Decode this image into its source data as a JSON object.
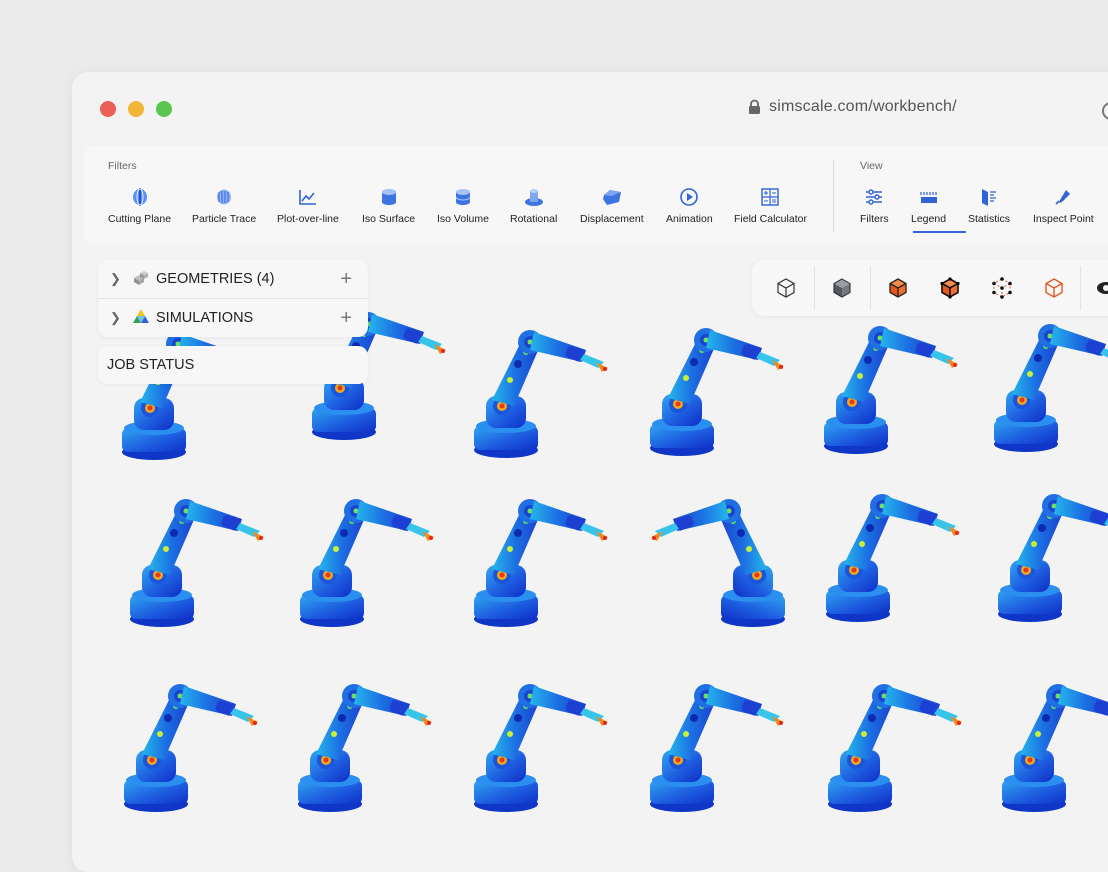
{
  "browser": {
    "url": "simscale.com/workbench/",
    "colors": {
      "close": "#ec5f57",
      "minimize": "#f1b637",
      "maximize": "#5ac64f"
    }
  },
  "toolbar": {
    "filters_title": "Filters",
    "view_title": "View",
    "filters": [
      {
        "label": "Cutting Plane",
        "icon": "cutting-plane-icon"
      },
      {
        "label": "Particle Trace",
        "icon": "particle-trace-icon"
      },
      {
        "label": "Plot-over-line",
        "icon": "plot-over-line-icon"
      },
      {
        "label": "Iso Surface",
        "icon": "iso-surface-icon"
      },
      {
        "label": "Iso Volume",
        "icon": "iso-volume-icon"
      },
      {
        "label": "Rotational",
        "icon": "rotational-icon"
      },
      {
        "label": "Displacement",
        "icon": "displacement-icon"
      },
      {
        "label": "Animation",
        "icon": "animation-icon"
      },
      {
        "label": "Field Calculator",
        "icon": "field-calculator-icon"
      }
    ],
    "view": [
      {
        "label": "Filters",
        "icon": "filters-icon"
      },
      {
        "label": "Legend",
        "icon": "legend-icon",
        "active": true
      },
      {
        "label": "Statistics",
        "icon": "statistics-icon"
      },
      {
        "label": "Inspect Point",
        "icon": "inspect-point-icon"
      }
    ],
    "accent": "#3267d6"
  },
  "tree": {
    "geometries_label": "GEOMETRIES",
    "geometries_count": "(4)",
    "simulations_label": "SIMULATIONS",
    "job_status_label": "JOB STATUS"
  },
  "viewbar": {
    "buttons": [
      "cube-outline-icon",
      "cube-solid-icon",
      "cube-orange-solid-icon",
      "cube-orange-edges-icon",
      "cube-points-icon",
      "cube-orange-outline-icon"
    ]
  },
  "viewport": {
    "content": "grid of robotic arm stress contour renders",
    "rows": 3,
    "columns": 6
  }
}
